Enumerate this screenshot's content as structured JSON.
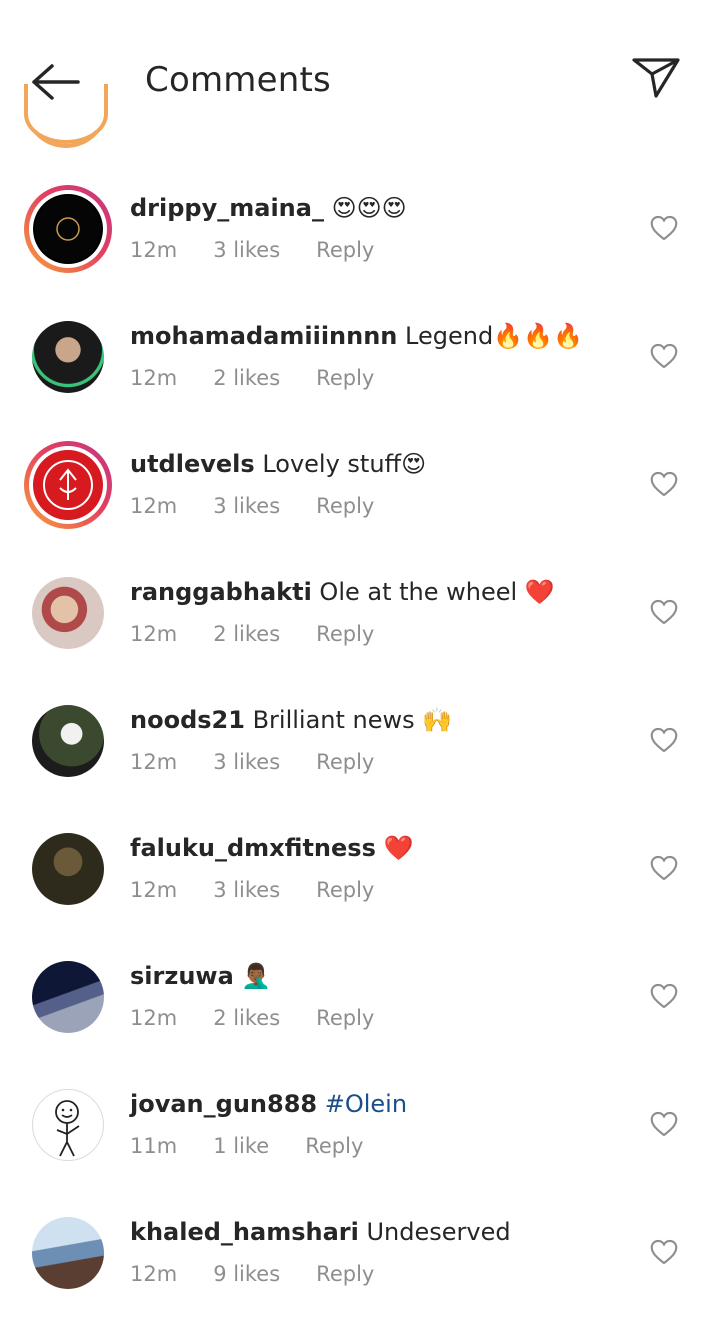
{
  "header": {
    "title": "Comments",
    "back_icon": "arrow-left-icon",
    "send_icon": "paper-plane-icon"
  },
  "comments": [
    {
      "username": "drippy_maina_",
      "text": " 😍😍😍",
      "time": "12m",
      "likes": "3 likes",
      "reply": "Reply",
      "avatar_color": "#111111"
    },
    {
      "username": "mohamadamiiinnnn",
      "text": " Legend🔥🔥🔥",
      "time": "12m",
      "likes": "2 likes",
      "reply": "Reply",
      "avatar_color": "#3a3a3a"
    },
    {
      "username": "utdlevels",
      "text": " Lovely stuff😍",
      "time": "12m",
      "likes": "3 likes",
      "reply": "Reply",
      "avatar_color": "#d71920"
    },
    {
      "username": "ranggabhakti",
      "text": " Ole at the wheel ❤️",
      "time": "12m",
      "likes": "2 likes",
      "reply": "Reply",
      "avatar_color": "#a27b6e"
    },
    {
      "username": "noods21",
      "text": " Brilliant news 🙌",
      "time": "12m",
      "likes": "3 likes",
      "reply": "Reply",
      "avatar_color": "#4e5a3c"
    },
    {
      "username": "faluku_dmxfitness",
      "text": " ❤️",
      "time": "12m",
      "likes": "3 likes",
      "reply": "Reply",
      "avatar_color": "#2b2a1c"
    },
    {
      "username": "sirzuwa",
      "text": " 🤦🏾‍♂️",
      "time": "12m",
      "likes": "2 likes",
      "reply": "Reply",
      "avatar_color": "#1e2d4f"
    },
    {
      "username": "jovan_gun888",
      "text": " ",
      "hashtag": "#Olein",
      "time": "11m",
      "likes": "1 like",
      "reply": "Reply",
      "avatar_color": "#ffffff"
    },
    {
      "username": "khaled_hamshari",
      "text": " Undeserved",
      "time": "12m",
      "likes": "9 likes",
      "reply": "Reply",
      "avatar_color": "#6d8fb3"
    }
  ],
  "icons": {
    "like": "heart-outline-icon"
  }
}
